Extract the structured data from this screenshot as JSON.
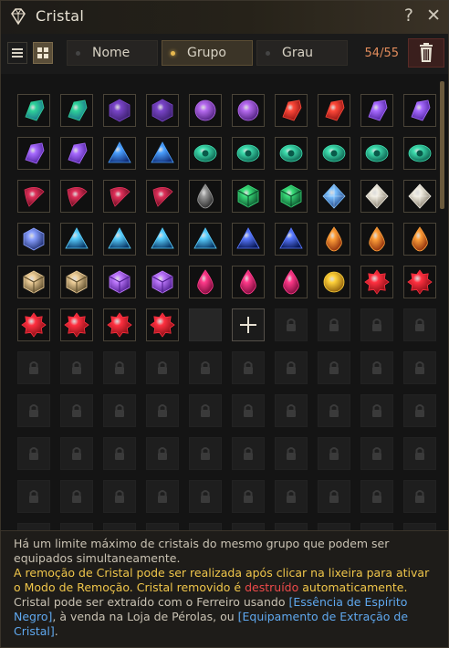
{
  "window": {
    "title": "Cristal",
    "help_label": "?",
    "close_label": "✕"
  },
  "toolbar": {
    "sort_tabs": [
      {
        "label": "Nome",
        "active": false
      },
      {
        "label": "Grupo",
        "active": true
      },
      {
        "label": "Grau",
        "active": false
      }
    ],
    "count": "54/55"
  },
  "grid": {
    "columns": 10,
    "total_rows": 11,
    "items": [
      "green-crystal",
      "green-crystal",
      "purple-hexagon-crystal",
      "purple-hexagon-crystal",
      "purple-orb-crystal",
      "purple-orb-crystal",
      "red-shard-crystal",
      "red-shard-crystal",
      "violet-shard-crystal",
      "violet-shard-crystal",
      "violet-shard-crystal",
      "violet-shard-crystal",
      "blue-triangle-crystal",
      "blue-triangle-crystal",
      "teal-eye-crystal",
      "teal-eye-crystal",
      "teal-eye-crystal",
      "teal-eye-crystal",
      "teal-eye-crystal",
      "teal-eye-crystal",
      "crimson-fang-crystal",
      "crimson-fang-crystal",
      "crimson-fang-crystal",
      "crimson-fang-crystal",
      "dark-drop-crystal",
      "emerald-cluster-crystal",
      "emerald-cluster-crystal",
      "blue-diamond-crystal",
      "white-diamond-crystal",
      "white-diamond-crystal",
      "indigo-hexagon-crystal",
      "cyan-pyramid-crystal",
      "cyan-pyramid-crystal",
      "cyan-pyramid-crystal",
      "cyan-pyramid-crystal",
      "navy-pyramid-crystal",
      "navy-pyramid-crystal",
      "orange-drop-crystal",
      "orange-drop-crystal",
      "orange-drop-crystal",
      "amber-cross-crystal",
      "amber-cross-crystal",
      "violet-cube-crystal",
      "violet-cube-crystal",
      "magenta-drop-crystal",
      "magenta-drop-crystal",
      "magenta-drop-crystal",
      "golden-sun-crystal",
      "ruby-gear-crystal",
      "ruby-gear-crystal",
      "ruby-gear-crystal",
      "ruby-gear-crystal",
      "ruby-gear-crystal",
      "ruby-gear-crystal"
    ],
    "empty_slots": 1,
    "add_slots": 1
  },
  "footer": {
    "line1": "Há um limite máximo de cristais do mesmo grupo que podem ser equipados simultaneamente.",
    "line2_a": "A remoção de Cristal pode ser realizada após clicar na ",
    "line2_hl": "lixeira",
    "line2_b": " para ativar o Modo de Remoção. Cristal removido é ",
    "line2_hl2": "destruído",
    "line2_c": " automaticamente.",
    "line3_a": "Cristal pode ser extraído com o Ferreiro usando ",
    "line3_hl": "[Essência de Espírito Negro]",
    "line3_b": ", à venda na Loja de Pérolas, ou ",
    "line3_hl2": "[Equipamento de Extração de Cristal]",
    "line3_c": "."
  },
  "colors": {
    "accent": "#e7b84f",
    "count": "#e28c5c",
    "highlight_yellow": "#f0c64a",
    "highlight_red": "#ee4a4a",
    "highlight_blue": "#5fa8ef"
  },
  "icons": {
    "title": "diamond-icon",
    "list_view": "list-icon",
    "grid_view": "grid-icon",
    "trash": "trash-icon",
    "lock": "lock-icon",
    "add": "plus-icon"
  }
}
